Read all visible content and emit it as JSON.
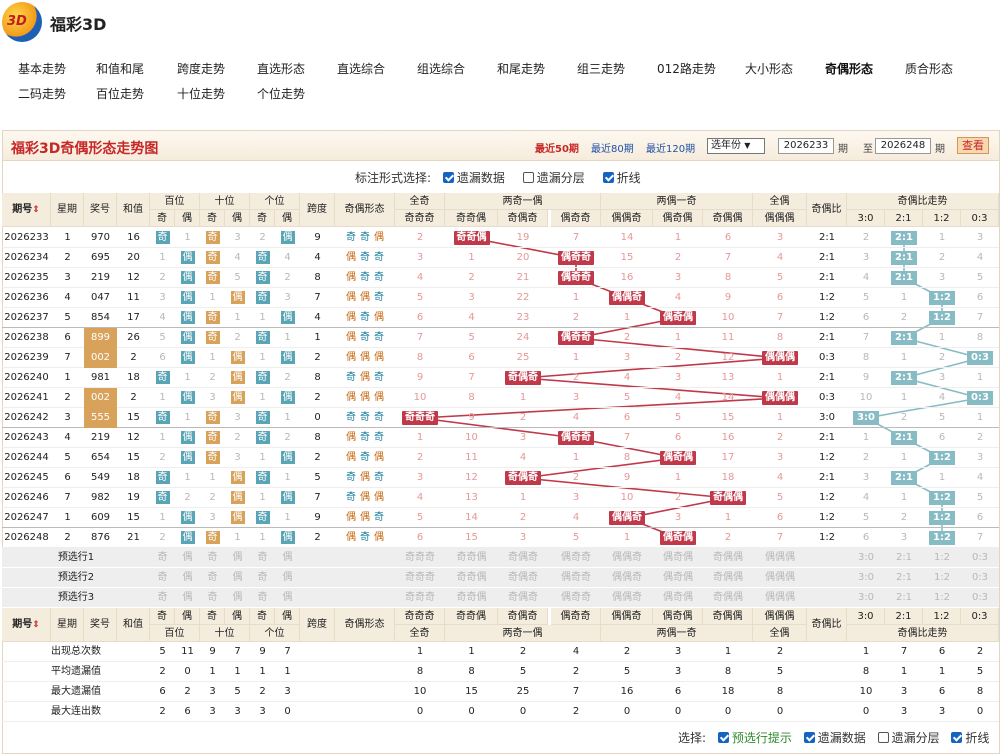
{
  "app": {
    "title": "福彩3D"
  },
  "nav": [
    "基本走势",
    "和值和尾",
    "跨度走势",
    "直选形态",
    "直选综合",
    "组选综合",
    "和尾走势",
    "组三走势",
    "012路走势",
    "大小形态",
    "奇偶形态",
    "质合形态",
    "二码走势",
    "百位走势",
    "十位走势",
    "个位走势"
  ],
  "nav_active": "奇偶形态",
  "panel": {
    "title": "福彩3D奇偶形态走势图",
    "ranges": [
      "最近50期",
      "最近80期",
      "最近120期"
    ],
    "year_select": "选年份",
    "from": "2026233",
    "to": "2026248",
    "qi": "期",
    "zhi": "至",
    "view_btn": "查看"
  },
  "opts": {
    "label": "标注形式选择:",
    "items": [
      {
        "label": "遗漏数据",
        "on": true
      },
      {
        "label": "遗漏分层",
        "on": false
      },
      {
        "label": "折线",
        "on": true
      }
    ]
  },
  "bottom_opts": {
    "label": "选择:",
    "items": [
      {
        "label": "预选行提示",
        "on": true
      },
      {
        "label": "遗漏数据",
        "on": true
      },
      {
        "label": "遗漏分层",
        "on": false
      },
      {
        "label": "折线",
        "on": true
      }
    ]
  },
  "headers": {
    "issue": "期号",
    "week": "星期",
    "num": "奖号",
    "sum": "和值",
    "bai": "百位",
    "shi": "十位",
    "ge": "个位",
    "odd": "奇",
    "even": "偶",
    "span": "跨度",
    "form": "奇偶形态",
    "all_odd": "全奇",
    "two_odd": "两奇一偶",
    "two_even": "两偶一奇",
    "all_even": "全偶",
    "ratio": "奇偶比",
    "ratio_trend": "奇偶比走势",
    "sub": [
      "奇奇奇",
      "奇奇偶",
      "奇偶奇",
      "偶奇奇",
      "偶偶奇",
      "偶奇偶",
      "奇偶偶",
      "偶偶偶"
    ],
    "ratio_cols": [
      "3:0",
      "2:1",
      "1:2",
      "0:3"
    ]
  },
  "rows": [
    {
      "issue": "2026233",
      "week": "1",
      "num": "970",
      "hl": false,
      "sum": "16",
      "span": "9",
      "pos": [
        [
          "奇",
          1
        ],
        [
          "奇",
          3
        ],
        [
          "2",
          "偶"
        ]
      ],
      "form": [
        "奇",
        "奇",
        "偶"
      ],
      "forms": [
        "2",
        "奇奇偶",
        "19",
        "7",
        "14",
        "1",
        "6",
        "3"
      ],
      "ratio": "2:1",
      "rt": [
        "2",
        "2:1",
        "1",
        "3"
      ]
    },
    {
      "issue": "2026234",
      "week": "2",
      "num": "695",
      "hl": false,
      "sum": "20",
      "span": "4",
      "pos": [
        [
          "1",
          "偶"
        ],
        [
          "奇",
          4
        ],
        [
          "奇",
          4
        ]
      ],
      "form": [
        "偶",
        "奇",
        "奇"
      ],
      "forms": [
        "3",
        "1",
        "20",
        "偶奇奇",
        "15",
        "2",
        "7",
        "4"
      ],
      "ratio": "2:1",
      "rt": [
        "3",
        "2:1",
        "2",
        "4"
      ]
    },
    {
      "issue": "2026235",
      "week": "3",
      "num": "219",
      "hl": false,
      "sum": "12",
      "span": "8",
      "pos": [
        [
          "2",
          "偶"
        ],
        [
          "奇",
          5
        ],
        [
          "奇",
          2
        ]
      ],
      "form": [
        "偶",
        "奇",
        "奇"
      ],
      "forms": [
        "4",
        "2",
        "21",
        "偶奇奇",
        "16",
        "3",
        "8",
        "5"
      ],
      "ratio": "2:1",
      "rt": [
        "4",
        "2:1",
        "3",
        "5"
      ]
    },
    {
      "issue": "2026236",
      "week": "4",
      "num": "047",
      "hl": false,
      "sum": "11",
      "span": "7",
      "pos": [
        [
          "3",
          "偶"
        ],
        [
          "1",
          "偶"
        ],
        [
          "奇",
          3
        ]
      ],
      "form": [
        "偶",
        "偶",
        "奇"
      ],
      "forms": [
        "5",
        "3",
        "22",
        "1",
        "偶偶奇",
        "4",
        "9",
        "6"
      ],
      "ratio": "1:2",
      "rt": [
        "5",
        "1",
        "1:2",
        "6"
      ]
    },
    {
      "issue": "2026237",
      "week": "5",
      "num": "854",
      "hl": false,
      "sum": "17",
      "span": "4",
      "pos": [
        [
          "4",
          "偶"
        ],
        [
          "奇",
          1
        ],
        [
          "1",
          "偶"
        ]
      ],
      "form": [
        "偶",
        "奇",
        "偶"
      ],
      "forms": [
        "6",
        "4",
        "23",
        "2",
        "1",
        "偶奇偶",
        "10",
        "7"
      ],
      "ratio": "1:2",
      "rt": [
        "6",
        "2",
        "1:2",
        "7"
      ]
    },
    {
      "issue": "2026238",
      "week": "6",
      "num": "899",
      "hl": true,
      "sum": "26",
      "span": "1",
      "pos": [
        [
          "5",
          "偶"
        ],
        [
          "奇",
          2
        ],
        [
          "奇",
          1
        ]
      ],
      "form": [
        "偶",
        "奇",
        "奇"
      ],
      "forms": [
        "7",
        "5",
        "24",
        "偶奇奇",
        "2",
        "1",
        "11",
        "8"
      ],
      "ratio": "2:1",
      "rt": [
        "7",
        "2:1",
        "1",
        "8"
      ]
    },
    {
      "issue": "2026239",
      "week": "7",
      "num": "002",
      "hl": true,
      "sum": "2",
      "span": "2",
      "pos": [
        [
          "6",
          "偶"
        ],
        [
          "1",
          "偶"
        ],
        [
          "1",
          "偶"
        ]
      ],
      "form": [
        "偶",
        "偶",
        "偶"
      ],
      "forms": [
        "8",
        "6",
        "25",
        "1",
        "3",
        "2",
        "12",
        "偶偶偶"
      ],
      "ratio": "0:3",
      "rt": [
        "8",
        "1",
        "2",
        "0:3"
      ]
    },
    {
      "issue": "2026240",
      "week": "1",
      "num": "981",
      "hl": false,
      "sum": "18",
      "span": "8",
      "pos": [
        [
          "奇",
          1
        ],
        [
          "2",
          "偶"
        ],
        [
          "奇",
          2
        ]
      ],
      "form": [
        "奇",
        "偶",
        "奇"
      ],
      "forms": [
        "9",
        "7",
        "奇偶奇",
        "2",
        "4",
        "3",
        "13",
        "1"
      ],
      "ratio": "2:1",
      "rt": [
        "9",
        "2:1",
        "3",
        "1"
      ]
    },
    {
      "issue": "2026241",
      "week": "2",
      "num": "002",
      "hl": true,
      "sum": "2",
      "span": "2",
      "pos": [
        [
          "1",
          "偶"
        ],
        [
          "3",
          "偶"
        ],
        [
          "1",
          "偶"
        ]
      ],
      "form": [
        "偶",
        "偶",
        "偶"
      ],
      "forms": [
        "10",
        "8",
        "1",
        "3",
        "5",
        "4",
        "14",
        "偶偶偶"
      ],
      "ratio": "0:3",
      "rt": [
        "10",
        "1",
        "4",
        "0:3"
      ]
    },
    {
      "issue": "2026242",
      "week": "3",
      "num": "555",
      "hl": true,
      "sum": "15",
      "span": "0",
      "pos": [
        [
          "奇",
          1
        ],
        [
          "奇",
          3
        ],
        [
          "奇",
          1
        ]
      ],
      "form": [
        "奇",
        "奇",
        "奇"
      ],
      "forms": [
        "奇奇奇",
        "9",
        "2",
        "4",
        "6",
        "5",
        "15",
        "1"
      ],
      "ratio": "3:0",
      "rt": [
        "3:0",
        "2",
        "5",
        "1"
      ]
    },
    {
      "issue": "2026243",
      "week": "4",
      "num": "219",
      "hl": false,
      "sum": "12",
      "span": "8",
      "pos": [
        [
          "1",
          "偶"
        ],
        [
          "奇",
          2
        ],
        [
          "奇",
          2
        ]
      ],
      "form": [
        "偶",
        "奇",
        "奇"
      ],
      "forms": [
        "1",
        "10",
        "3",
        "偶奇奇",
        "7",
        "6",
        "16",
        "2"
      ],
      "ratio": "2:1",
      "rt": [
        "1",
        "2:1",
        "6",
        "2"
      ]
    },
    {
      "issue": "2026244",
      "week": "5",
      "num": "654",
      "hl": false,
      "sum": "15",
      "span": "2",
      "pos": [
        [
          "2",
          "偶"
        ],
        [
          "奇",
          3
        ],
        [
          "1",
          "偶"
        ]
      ],
      "form": [
        "偶",
        "奇",
        "偶"
      ],
      "forms": [
        "2",
        "11",
        "4",
        "1",
        "8",
        "偶奇偶",
        "17",
        "3"
      ],
      "ratio": "1:2",
      "rt": [
        "2",
        "1",
        "1:2",
        "3"
      ]
    },
    {
      "issue": "2026245",
      "week": "6",
      "num": "549",
      "hl": false,
      "sum": "18",
      "span": "5",
      "pos": [
        [
          "奇",
          1
        ],
        [
          "1",
          "偶"
        ],
        [
          "奇",
          1
        ]
      ],
      "form": [
        "奇",
        "偶",
        "奇"
      ],
      "forms": [
        "3",
        "12",
        "奇偶奇",
        "2",
        "9",
        "1",
        "18",
        "4"
      ],
      "ratio": "2:1",
      "rt": [
        "3",
        "2:1",
        "1",
        "4"
      ]
    },
    {
      "issue": "2026246",
      "week": "7",
      "num": "982",
      "hl": false,
      "sum": "19",
      "span": "7",
      "pos": [
        [
          "奇",
          2
        ],
        [
          "2",
          "偶"
        ],
        [
          "1",
          "偶"
        ]
      ],
      "form": [
        "奇",
        "偶",
        "偶"
      ],
      "forms": [
        "4",
        "13",
        "1",
        "3",
        "10",
        "2",
        "奇偶偶",
        "5"
      ],
      "ratio": "1:2",
      "rt": [
        "4",
        "1",
        "1:2",
        "5"
      ]
    },
    {
      "issue": "2026247",
      "week": "1",
      "num": "609",
      "hls": false,
      "sum": "15",
      "span": "9",
      "pos": [
        [
          "1",
          "偶"
        ],
        [
          "3",
          "偶"
        ],
        [
          "奇",
          1
        ]
      ],
      "form": [
        "偶",
        "偶",
        "奇"
      ],
      "forms": [
        "5",
        "14",
        "2",
        "4",
        "偶偶奇",
        "3",
        "1",
        "6"
      ],
      "ratio": "1:2",
      "rt": [
        "5",
        "2",
        "1:2",
        "6"
      ]
    },
    {
      "issue": "2026248",
      "week": "2",
      "num": "876",
      "hl": false,
      "sum": "21",
      "span": "2",
      "pos": [
        [
          "2",
          "偶"
        ],
        [
          "奇",
          1
        ],
        [
          "1",
          "偶"
        ]
      ],
      "form": [
        "偶",
        "奇",
        "偶"
      ],
      "forms": [
        "6",
        "15",
        "3",
        "5",
        "1",
        "偶奇偶",
        "2",
        "7"
      ],
      "ratio": "1:2",
      "rt": [
        "6",
        "3",
        "1:2",
        "7"
      ]
    }
  ],
  "pre_rows": [
    "预选行1",
    "预选行2",
    "预选行3"
  ],
  "stats": [
    {
      "label": "出现总次数",
      "pos": [
        "5",
        "11",
        "9",
        "7",
        "9",
        "7"
      ],
      "forms": [
        "1",
        "1",
        "2",
        "4",
        "2",
        "3",
        "1",
        "2"
      ],
      "rt": [
        "1",
        "7",
        "6",
        "2"
      ]
    },
    {
      "label": "平均遗漏值",
      "pos": [
        "2",
        "0",
        "1",
        "1",
        "1",
        "1"
      ],
      "forms": [
        "8",
        "8",
        "5",
        "2",
        "5",
        "3",
        "8",
        "5"
      ],
      "rt": [
        "8",
        "1",
        "1",
        "5"
      ]
    },
    {
      "label": "最大遗漏值",
      "pos": [
        "6",
        "2",
        "3",
        "5",
        "2",
        "3"
      ],
      "forms": [
        "10",
        "15",
        "25",
        "7",
        "16",
        "6",
        "18",
        "8"
      ],
      "rt": [
        "10",
        "3",
        "6",
        "8"
      ]
    },
    {
      "label": "最大连出数",
      "pos": [
        "2",
        "6",
        "3",
        "3",
        "3",
        "0"
      ],
      "forms": [
        "0",
        "0",
        "0",
        "2",
        "0",
        "0",
        "0",
        "0"
      ],
      "rt": [
        "0",
        "3",
        "3",
        "0"
      ]
    }
  ]
}
